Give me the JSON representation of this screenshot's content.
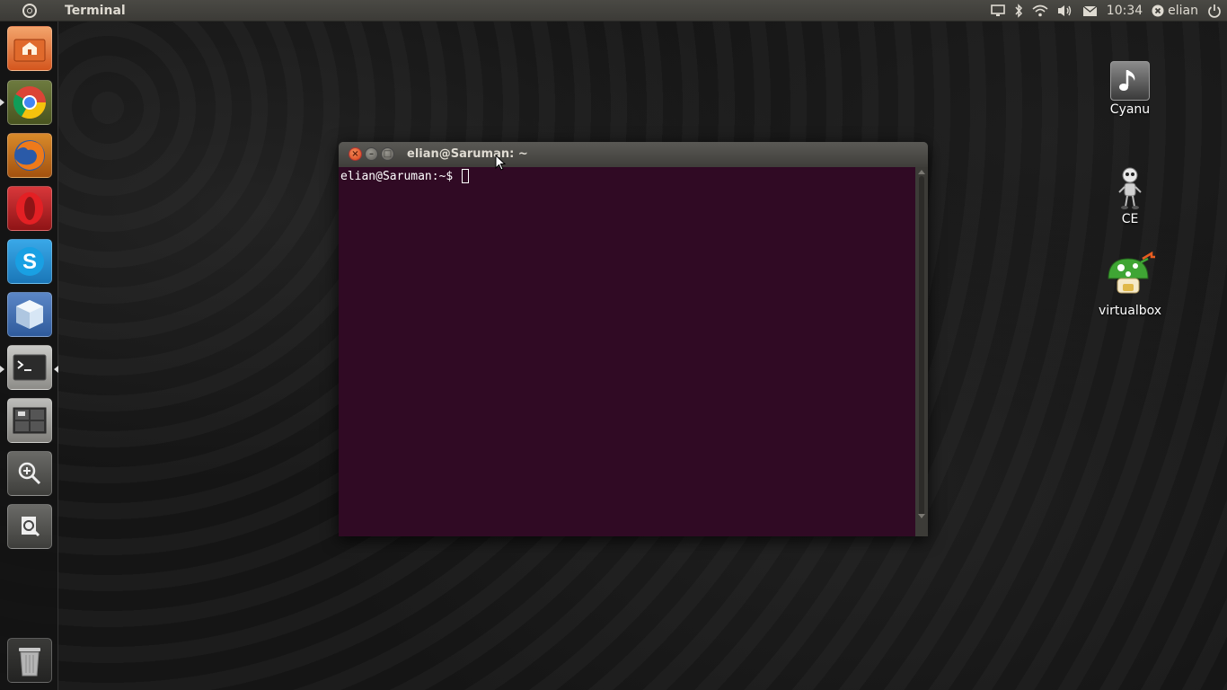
{
  "panel": {
    "app_title": "Terminal",
    "clock": "10:34",
    "user": "elian"
  },
  "launcher": {
    "items": [
      {
        "name": "Home Folder",
        "icon": "home-folder-icon"
      },
      {
        "name": "Google Chrome",
        "icon": "chrome-icon"
      },
      {
        "name": "Firefox",
        "icon": "firefox-icon"
      },
      {
        "name": "Opera",
        "icon": "opera-icon"
      },
      {
        "name": "Skype",
        "icon": "skype-icon"
      },
      {
        "name": "VirtualBox",
        "icon": "cube-icon"
      },
      {
        "name": "Terminal",
        "icon": "terminal-icon"
      },
      {
        "name": "Workspaces",
        "icon": "workspace-switcher-icon"
      },
      {
        "name": "Zoom",
        "icon": "magnifier-icon"
      },
      {
        "name": "Search",
        "icon": "search-file-icon"
      },
      {
        "name": "Trash",
        "icon": "trash-icon"
      }
    ]
  },
  "desktop": {
    "icons": [
      {
        "label": "Cyanu",
        "icon": "music-note-icon"
      },
      {
        "label": "CE",
        "icon": "robot-icon"
      },
      {
        "label": "virtualbox",
        "icon": "virtualbox-mushroom-icon"
      }
    ]
  },
  "terminal": {
    "title": "elian@Saruman: ~",
    "prompt": "elian@Saruman:~$ ",
    "background": "#300a24",
    "close_glyph": "×",
    "min_glyph": "–",
    "max_glyph": "□"
  }
}
